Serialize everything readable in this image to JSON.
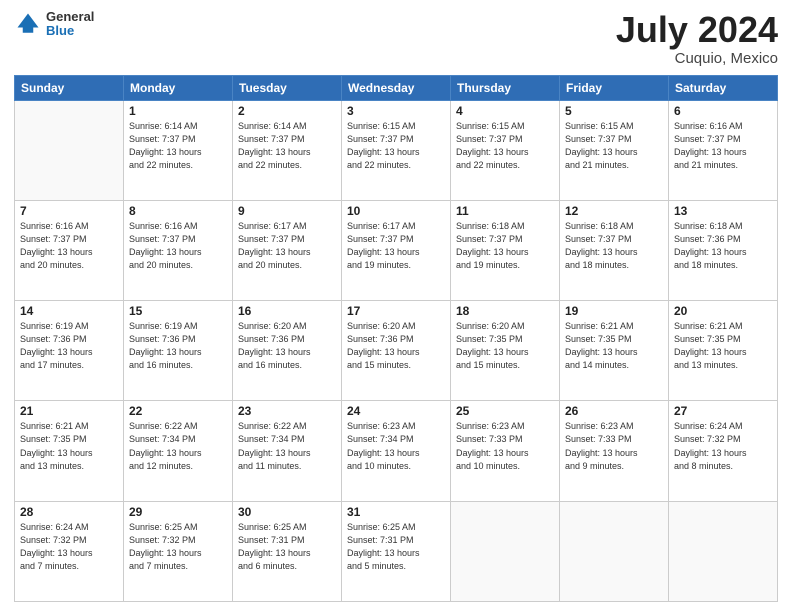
{
  "header": {
    "logo_general": "General",
    "logo_blue": "Blue",
    "title": "July 2024",
    "location": "Cuquio, Mexico"
  },
  "days_of_week": [
    "Sunday",
    "Monday",
    "Tuesday",
    "Wednesday",
    "Thursday",
    "Friday",
    "Saturday"
  ],
  "weeks": [
    [
      {
        "day": "",
        "info": ""
      },
      {
        "day": "1",
        "info": "Sunrise: 6:14 AM\nSunset: 7:37 PM\nDaylight: 13 hours\nand 22 minutes."
      },
      {
        "day": "2",
        "info": "Sunrise: 6:14 AM\nSunset: 7:37 PM\nDaylight: 13 hours\nand 22 minutes."
      },
      {
        "day": "3",
        "info": "Sunrise: 6:15 AM\nSunset: 7:37 PM\nDaylight: 13 hours\nand 22 minutes."
      },
      {
        "day": "4",
        "info": "Sunrise: 6:15 AM\nSunset: 7:37 PM\nDaylight: 13 hours\nand 22 minutes."
      },
      {
        "day": "5",
        "info": "Sunrise: 6:15 AM\nSunset: 7:37 PM\nDaylight: 13 hours\nand 21 minutes."
      },
      {
        "day": "6",
        "info": "Sunrise: 6:16 AM\nSunset: 7:37 PM\nDaylight: 13 hours\nand 21 minutes."
      }
    ],
    [
      {
        "day": "7",
        "info": "Sunrise: 6:16 AM\nSunset: 7:37 PM\nDaylight: 13 hours\nand 20 minutes."
      },
      {
        "day": "8",
        "info": "Sunrise: 6:16 AM\nSunset: 7:37 PM\nDaylight: 13 hours\nand 20 minutes."
      },
      {
        "day": "9",
        "info": "Sunrise: 6:17 AM\nSunset: 7:37 PM\nDaylight: 13 hours\nand 20 minutes."
      },
      {
        "day": "10",
        "info": "Sunrise: 6:17 AM\nSunset: 7:37 PM\nDaylight: 13 hours\nand 19 minutes."
      },
      {
        "day": "11",
        "info": "Sunrise: 6:18 AM\nSunset: 7:37 PM\nDaylight: 13 hours\nand 19 minutes."
      },
      {
        "day": "12",
        "info": "Sunrise: 6:18 AM\nSunset: 7:37 PM\nDaylight: 13 hours\nand 18 minutes."
      },
      {
        "day": "13",
        "info": "Sunrise: 6:18 AM\nSunset: 7:36 PM\nDaylight: 13 hours\nand 18 minutes."
      }
    ],
    [
      {
        "day": "14",
        "info": "Sunrise: 6:19 AM\nSunset: 7:36 PM\nDaylight: 13 hours\nand 17 minutes."
      },
      {
        "day": "15",
        "info": "Sunrise: 6:19 AM\nSunset: 7:36 PM\nDaylight: 13 hours\nand 16 minutes."
      },
      {
        "day": "16",
        "info": "Sunrise: 6:20 AM\nSunset: 7:36 PM\nDaylight: 13 hours\nand 16 minutes."
      },
      {
        "day": "17",
        "info": "Sunrise: 6:20 AM\nSunset: 7:36 PM\nDaylight: 13 hours\nand 15 minutes."
      },
      {
        "day": "18",
        "info": "Sunrise: 6:20 AM\nSunset: 7:35 PM\nDaylight: 13 hours\nand 15 minutes."
      },
      {
        "day": "19",
        "info": "Sunrise: 6:21 AM\nSunset: 7:35 PM\nDaylight: 13 hours\nand 14 minutes."
      },
      {
        "day": "20",
        "info": "Sunrise: 6:21 AM\nSunset: 7:35 PM\nDaylight: 13 hours\nand 13 minutes."
      }
    ],
    [
      {
        "day": "21",
        "info": "Sunrise: 6:21 AM\nSunset: 7:35 PM\nDaylight: 13 hours\nand 13 minutes."
      },
      {
        "day": "22",
        "info": "Sunrise: 6:22 AM\nSunset: 7:34 PM\nDaylight: 13 hours\nand 12 minutes."
      },
      {
        "day": "23",
        "info": "Sunrise: 6:22 AM\nSunset: 7:34 PM\nDaylight: 13 hours\nand 11 minutes."
      },
      {
        "day": "24",
        "info": "Sunrise: 6:23 AM\nSunset: 7:34 PM\nDaylight: 13 hours\nand 10 minutes."
      },
      {
        "day": "25",
        "info": "Sunrise: 6:23 AM\nSunset: 7:33 PM\nDaylight: 13 hours\nand 10 minutes."
      },
      {
        "day": "26",
        "info": "Sunrise: 6:23 AM\nSunset: 7:33 PM\nDaylight: 13 hours\nand 9 minutes."
      },
      {
        "day": "27",
        "info": "Sunrise: 6:24 AM\nSunset: 7:32 PM\nDaylight: 13 hours\nand 8 minutes."
      }
    ],
    [
      {
        "day": "28",
        "info": "Sunrise: 6:24 AM\nSunset: 7:32 PM\nDaylight: 13 hours\nand 7 minutes."
      },
      {
        "day": "29",
        "info": "Sunrise: 6:25 AM\nSunset: 7:32 PM\nDaylight: 13 hours\nand 7 minutes."
      },
      {
        "day": "30",
        "info": "Sunrise: 6:25 AM\nSunset: 7:31 PM\nDaylight: 13 hours\nand 6 minutes."
      },
      {
        "day": "31",
        "info": "Sunrise: 6:25 AM\nSunset: 7:31 PM\nDaylight: 13 hours\nand 5 minutes."
      },
      {
        "day": "",
        "info": ""
      },
      {
        "day": "",
        "info": ""
      },
      {
        "day": "",
        "info": ""
      }
    ]
  ]
}
